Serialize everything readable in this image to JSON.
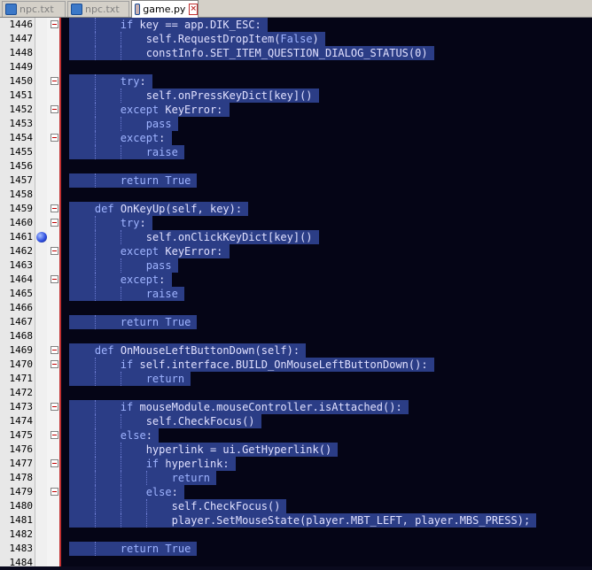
{
  "tabs": [
    {
      "label": "npc.txt",
      "icon": "file-icon",
      "active": false
    },
    {
      "label": "npc.txt",
      "icon": "file-icon",
      "active": false
    },
    {
      "label": "game.py",
      "icon": "file-icon",
      "active": true
    }
  ],
  "lines": [
    {
      "n": "1446",
      "text": "        if key == app.DIK_ESC:",
      "fold": true,
      "sel": true
    },
    {
      "n": "1447",
      "text": "            self.RequestDropItem(False)",
      "fold": false,
      "sel": true
    },
    {
      "n": "1448",
      "text": "            constInfo.SET_ITEM_QUESTION_DIALOG_STATUS(0)",
      "fold": false,
      "sel": true
    },
    {
      "n": "1449",
      "text": "",
      "fold": false,
      "sel": true
    },
    {
      "n": "1450",
      "text": "        try:",
      "fold": true,
      "sel": true
    },
    {
      "n": "1451",
      "text": "            self.onPressKeyDict[key]()",
      "fold": false,
      "sel": true
    },
    {
      "n": "1452",
      "text": "        except KeyError:",
      "fold": true,
      "sel": true
    },
    {
      "n": "1453",
      "text": "            pass",
      "fold": false,
      "sel": true
    },
    {
      "n": "1454",
      "text": "        except:",
      "fold": true,
      "sel": true
    },
    {
      "n": "1455",
      "text": "            raise",
      "fold": false,
      "sel": true
    },
    {
      "n": "1456",
      "text": "",
      "fold": false,
      "sel": true
    },
    {
      "n": "1457",
      "text": "        return True",
      "fold": false,
      "sel": true
    },
    {
      "n": "1458",
      "text": "",
      "fold": false,
      "sel": true
    },
    {
      "n": "1459",
      "text": "    def OnKeyUp(self, key):",
      "fold": true,
      "sel": true
    },
    {
      "n": "1460",
      "text": "        try:",
      "fold": true,
      "sel": true
    },
    {
      "n": "1461",
      "text": "            self.onClickKeyDict[key]()",
      "fold": false,
      "sel": true,
      "bp": true
    },
    {
      "n": "1462",
      "text": "        except KeyError:",
      "fold": true,
      "sel": true
    },
    {
      "n": "1463",
      "text": "            pass",
      "fold": false,
      "sel": true
    },
    {
      "n": "1464",
      "text": "        except:",
      "fold": true,
      "sel": true
    },
    {
      "n": "1465",
      "text": "            raise",
      "fold": false,
      "sel": true
    },
    {
      "n": "1466",
      "text": "",
      "fold": false,
      "sel": true
    },
    {
      "n": "1467",
      "text": "        return True",
      "fold": false,
      "sel": true
    },
    {
      "n": "1468",
      "text": "",
      "fold": false,
      "sel": true
    },
    {
      "n": "1469",
      "text": "    def OnMouseLeftButtonDown(self):",
      "fold": true,
      "sel": true
    },
    {
      "n": "1470",
      "text": "        if self.interface.BUILD_OnMouseLeftButtonDown():",
      "fold": true,
      "sel": true
    },
    {
      "n": "1471",
      "text": "            return",
      "fold": false,
      "sel": true
    },
    {
      "n": "1472",
      "text": "",
      "fold": false,
      "sel": true
    },
    {
      "n": "1473",
      "text": "        if mouseModule.mouseController.isAttached():",
      "fold": true,
      "sel": true
    },
    {
      "n": "1474",
      "text": "            self.CheckFocus()",
      "fold": false,
      "sel": true
    },
    {
      "n": "1475",
      "text": "        else:",
      "fold": true,
      "sel": true
    },
    {
      "n": "1476",
      "text": "            hyperlink = ui.GetHyperlink()",
      "fold": false,
      "sel": true
    },
    {
      "n": "1477",
      "text": "            if hyperlink:",
      "fold": true,
      "sel": true
    },
    {
      "n": "1478",
      "text": "                return",
      "fold": false,
      "sel": true
    },
    {
      "n": "1479",
      "text": "            else:",
      "fold": true,
      "sel": true
    },
    {
      "n": "1480",
      "text": "                self.CheckFocus()",
      "fold": false,
      "sel": true
    },
    {
      "n": "1481",
      "text": "                player.SetMouseState(player.MBT_LEFT, player.MBS_PRESS);",
      "fold": false,
      "sel": true
    },
    {
      "n": "1482",
      "text": "",
      "fold": false,
      "sel": true
    },
    {
      "n": "1483",
      "text": "        return True",
      "fold": false,
      "sel": true
    },
    {
      "n": "1484",
      "text": "",
      "fold": false,
      "sel": false
    }
  ],
  "colors": {
    "selection": "#2b3d86",
    "background": "#050516",
    "fold_marker": "#c23030"
  }
}
